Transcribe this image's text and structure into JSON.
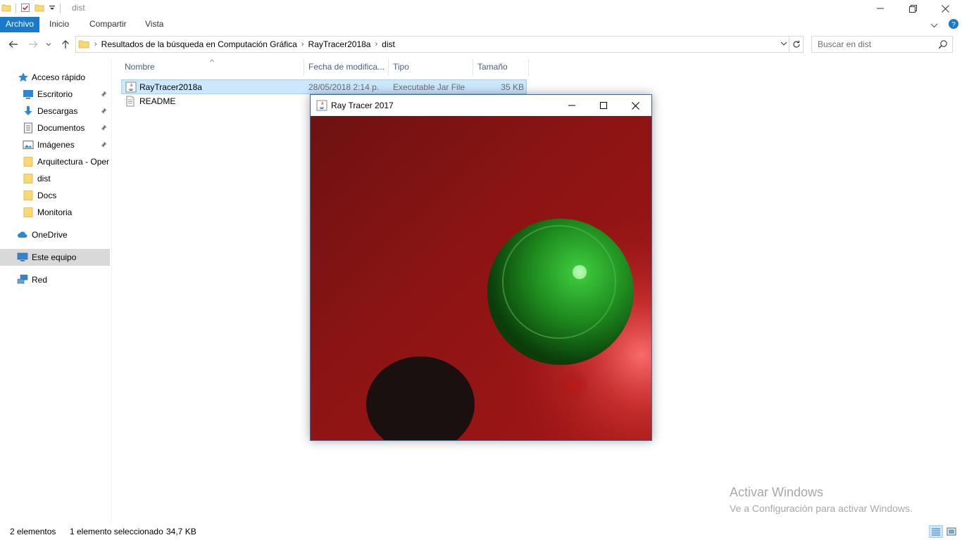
{
  "window": {
    "title": "dist",
    "controls": {
      "minimize": "minimize-icon",
      "restore": "restore-icon",
      "close": "close-icon"
    }
  },
  "ribbon": {
    "tabs": [
      "Archivo",
      "Inicio",
      "Compartir",
      "Vista"
    ],
    "accent_color": "#1979ca"
  },
  "address": {
    "breadcrumbs": [
      "Resultados de la búsqueda en Computación Gráfica",
      "RayTracer2018a",
      "dist"
    ]
  },
  "search": {
    "placeholder": "Buscar en dist"
  },
  "nav": {
    "quick_access": "Acceso rápido",
    "pinned": [
      {
        "label": "Escritorio",
        "icon": "desktop-icon"
      },
      {
        "label": "Descargas",
        "icon": "download-icon"
      },
      {
        "label": "Documentos",
        "icon": "documents-icon"
      },
      {
        "label": "Imágenes",
        "icon": "pictures-icon"
      }
    ],
    "folders": [
      "Arquitectura - Oper",
      "dist",
      "Docs",
      "Monitoria"
    ],
    "onedrive": "OneDrive",
    "this_pc": "Este equipo",
    "network": "Red"
  },
  "columns": [
    "Nombre",
    "Fecha de modifica...",
    "Tipo",
    "Tamaño"
  ],
  "files": [
    {
      "name": "RayTracer2018a",
      "date": "28/05/2018 2:14 p.",
      "type": "Executable Jar File",
      "size": "35 KB",
      "selected": true
    },
    {
      "name": "README",
      "date": "",
      "type": "",
      "size": "",
      "selected": false
    }
  ],
  "status": {
    "count": "2 elementos",
    "selection": "1 elemento seleccionado",
    "size": "34,7 KB"
  },
  "watermark": {
    "title": "Activar Windows",
    "subtitle": "Ve a Configuración para activar Windows."
  },
  "raytracer": {
    "title": "Ray Tracer 2017",
    "background_color": "#a01414",
    "sphere_color": "#1f9a1f",
    "shadow_color": "#1a1010"
  }
}
